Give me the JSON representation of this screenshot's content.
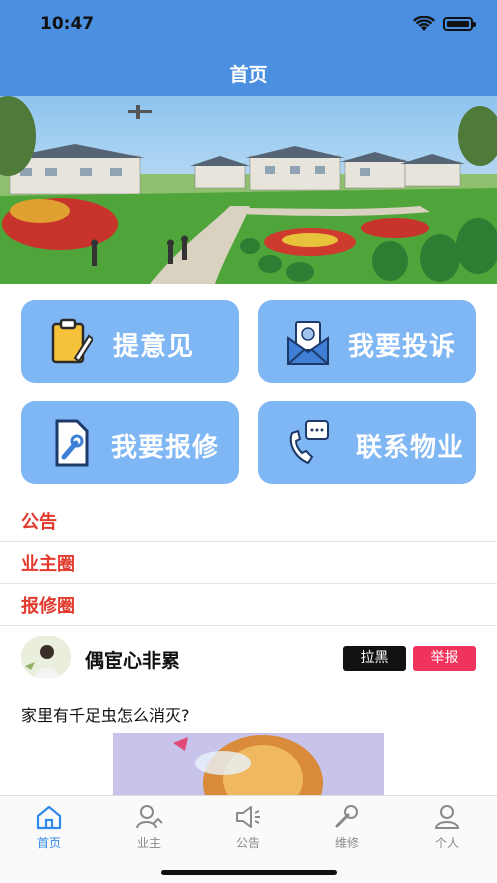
{
  "status_bar": {
    "time": "10:47"
  },
  "header": {
    "title": "首页"
  },
  "actions": [
    {
      "label": "提意见",
      "icon": "clipboard-icon"
    },
    {
      "label": "我要投诉",
      "icon": "envelope-icon"
    },
    {
      "label": "我要报修",
      "icon": "wrench-document-icon"
    },
    {
      "label": "联系物业",
      "icon": "phone-chat-icon"
    }
  ],
  "sections": [
    {
      "label": "公告"
    },
    {
      "label": "业主圈"
    },
    {
      "label": "报修圈"
    }
  ],
  "post": {
    "username": "偶宦心非累",
    "block_label": "拉黑",
    "report_label": "举报",
    "text": "家里有千足虫怎么消灭?"
  },
  "tabbar": [
    {
      "label": "首页",
      "icon": "home-icon",
      "active": true
    },
    {
      "label": "业主",
      "icon": "owner-icon",
      "active": false
    },
    {
      "label": "公告",
      "icon": "megaphone-icon",
      "active": false
    },
    {
      "label": "维修",
      "icon": "wrench-icon",
      "active": false
    },
    {
      "label": "个人",
      "icon": "person-icon",
      "active": false
    }
  ],
  "colors": {
    "header_blue": "#4a8fe0",
    "tile_blue": "#7fb6f4",
    "section_red": "#e23b2e",
    "report_pink": "#f0335c",
    "tab_active": "#2f8ae8"
  }
}
